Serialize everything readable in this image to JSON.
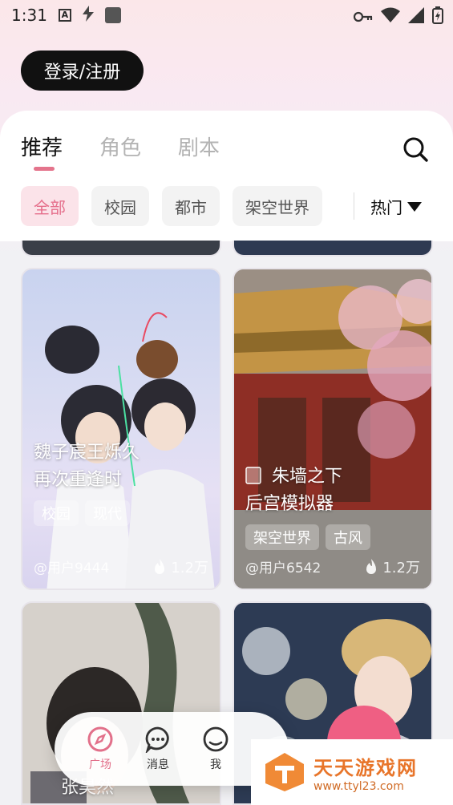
{
  "status_bar": {
    "time": "1:31"
  },
  "header": {
    "login_label": "登录/注册"
  },
  "tabs": [
    {
      "label": "推荐",
      "active": true
    },
    {
      "label": "角色",
      "active": false
    },
    {
      "label": "剧本",
      "active": false
    }
  ],
  "filters": {
    "chips": [
      {
        "label": "全部",
        "active": true
      },
      {
        "label": "校园",
        "active": false
      },
      {
        "label": "都市",
        "active": false
      },
      {
        "label": "架空世界",
        "active": false
      }
    ],
    "sort_label": "热门"
  },
  "cards": [
    {
      "title_line1": "魏子宸王烁久",
      "title_line2": "再次重逢时",
      "tags": [
        "校园",
        "现代"
      ],
      "author": "@用户9444",
      "likes": "1.2万"
    },
    {
      "title_line1": "朱墙之下",
      "title_line2": "后宫模拟器",
      "tags": [
        "架空世界",
        "古风"
      ],
      "author": "@用户6542",
      "likes": "1.2万"
    },
    {
      "title_line1": "张昊然",
      "title_line2": "",
      "tags": [],
      "author": "",
      "likes": ""
    }
  ],
  "bottom_nav": [
    {
      "label": "广场",
      "icon": "compass-icon",
      "active": true
    },
    {
      "label": "消息",
      "icon": "chat-icon",
      "active": false
    },
    {
      "label": "我",
      "icon": "profile-icon",
      "active": false
    }
  ],
  "watermark": {
    "title": "天天游戏网",
    "url": "www.ttyl23.com"
  },
  "colors": {
    "accent": "#e4748c",
    "chip_active_bg": "#fbe3e9"
  }
}
